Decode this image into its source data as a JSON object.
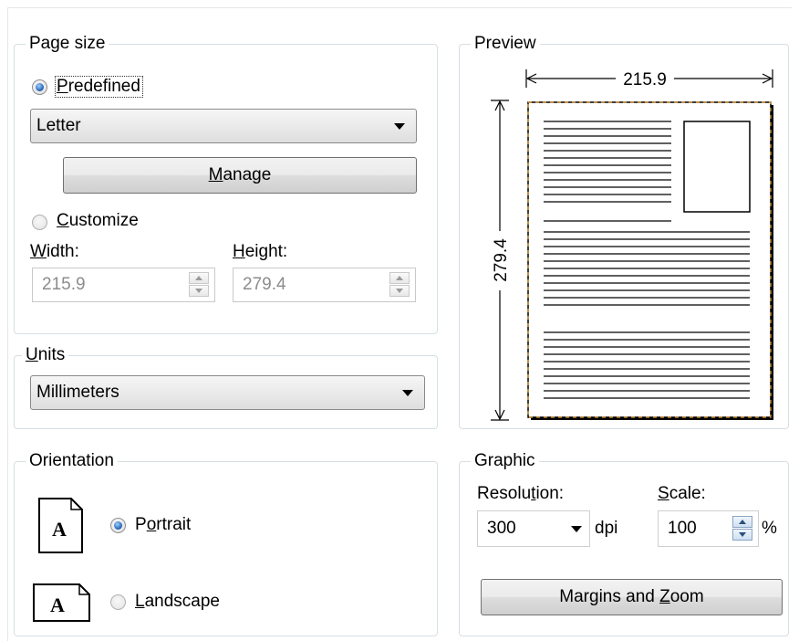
{
  "page_size": {
    "legend": "Page size",
    "predefined": {
      "pre": "",
      "key": "P",
      "post": "redefined",
      "checked": true
    },
    "paper_select": {
      "value": "Letter"
    },
    "manage_button": {
      "pre": "",
      "key": "M",
      "post": "anage"
    },
    "customize": {
      "pre": "",
      "key": "C",
      "post": "ustomize",
      "checked": false
    },
    "width_label": {
      "pre": "",
      "key": "W",
      "post": "idth:"
    },
    "height_label": {
      "pre": "",
      "key": "H",
      "post": "eight:"
    },
    "width_value": "215.9",
    "height_value": "279.4"
  },
  "units": {
    "legend": {
      "pre": "",
      "key": "U",
      "post": "nits"
    },
    "select": {
      "value": "Millimeters"
    }
  },
  "preview": {
    "legend": "Preview",
    "width_dim": "215.9",
    "height_dim": "279.4"
  },
  "orientation": {
    "legend": "Orientation",
    "icon_letter": "A",
    "portrait": {
      "pre": "P",
      "key": "o",
      "post": "rtrait",
      "checked": true
    },
    "landscape": {
      "pre": "",
      "key": "L",
      "post": "andscape",
      "checked": false
    }
  },
  "graphic": {
    "legend": "Graphic",
    "resolution_label": {
      "pre": "Resolu",
      "key": "t",
      "post": "ion:"
    },
    "resolution_value": "300",
    "dpi_unit": "dpi",
    "scale_label": {
      "pre": "",
      "key": "S",
      "post": "cale:"
    },
    "scale_value": "100",
    "percent_unit": "%",
    "margins_button": {
      "pre": "Margins and ",
      "key": "Z",
      "post": "oom"
    }
  }
}
